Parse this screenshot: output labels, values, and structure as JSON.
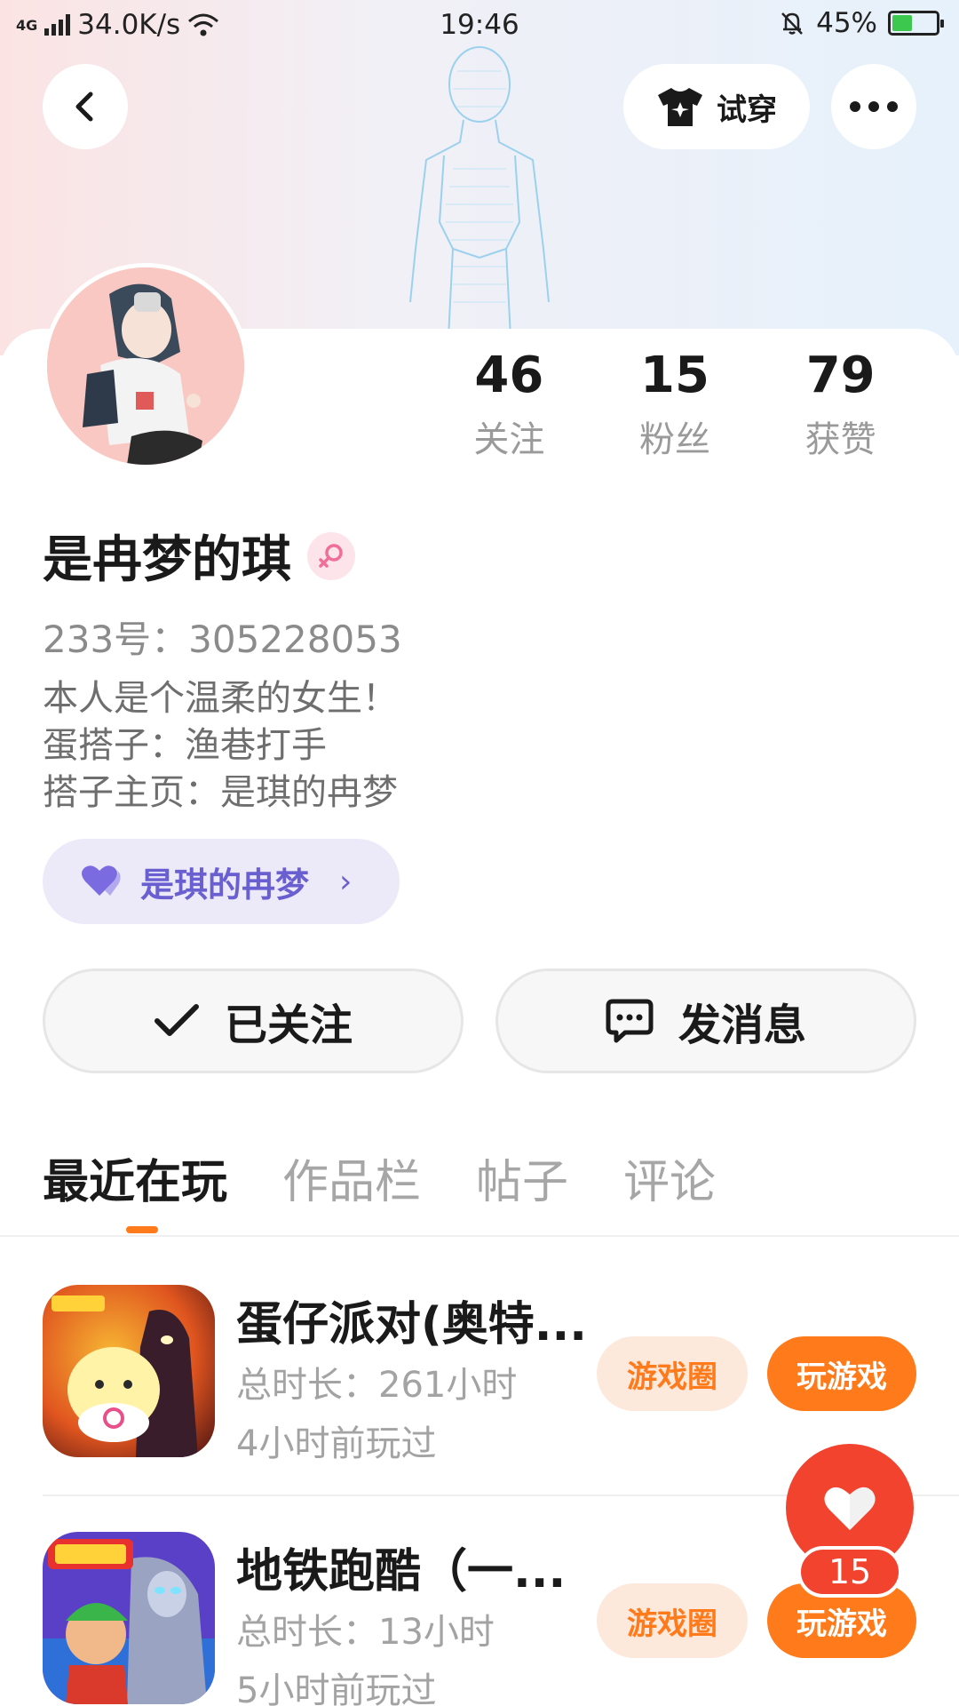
{
  "status_bar": {
    "network": "4G",
    "speed": "34.0K/s",
    "time": "19:46",
    "battery": "45%"
  },
  "header": {
    "tryon_label": "试穿"
  },
  "profile": {
    "stats": [
      {
        "value": "46",
        "label": "关注"
      },
      {
        "value": "15",
        "label": "粉丝"
      },
      {
        "value": "79",
        "label": "获赞"
      }
    ],
    "name": "是冉梦的琪",
    "uid": "233号：305228053",
    "bio": [
      "本人是个温柔的女生！",
      "蛋搭子：渔巷打手",
      "搭子主页：是琪的冉梦"
    ],
    "pair_link": "是琪的冉梦",
    "follow_button": "已关注",
    "message_button": "发消息"
  },
  "tabs": [
    "最近在玩",
    "作品栏",
    "帖子",
    "评论"
  ],
  "games": [
    {
      "title": "蛋仔派对(奥特...",
      "duration": "总时长：261小时",
      "last_played": "4小时前玩过",
      "circle_label": "游戏圈",
      "play_label": "玩游戏"
    },
    {
      "title": "地铁跑酷（一...",
      "duration": "总时长：13小时",
      "last_played": "5小时前玩过",
      "circle_label": "游戏圈",
      "play_label": "玩游戏"
    }
  ],
  "like_fab": {
    "count": "15"
  },
  "colors": {
    "accent_orange": "#ff7a1a",
    "like_red": "#f2432f",
    "pair_purple": "#6a5fd1"
  }
}
